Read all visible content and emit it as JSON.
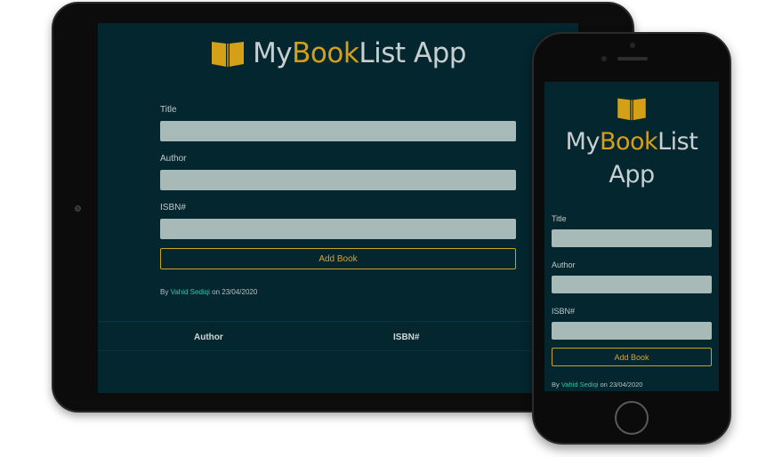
{
  "app": {
    "title_prefix": "My",
    "title_accent": "Book",
    "title_suffix": "List App",
    "phone_title_suffix_1": "List",
    "phone_title_suffix_2": "App",
    "icon": "book-open-icon"
  },
  "form": {
    "title_label": "Title",
    "author_label": "Author",
    "isbn_label": "ISBN#",
    "title_value": "",
    "author_value": "",
    "isbn_value": "",
    "submit_label": "Add Book"
  },
  "byline": {
    "prefix": "By",
    "author": "Vahid Sediqi",
    "date_text": "on 23/04/2020"
  },
  "table": {
    "headers": [
      "Author",
      "ISBN#"
    ]
  },
  "colors": {
    "background": "#04262f",
    "accent": "#d4a017",
    "input_fill": "#a7bab8",
    "link": "#31c6a6"
  }
}
